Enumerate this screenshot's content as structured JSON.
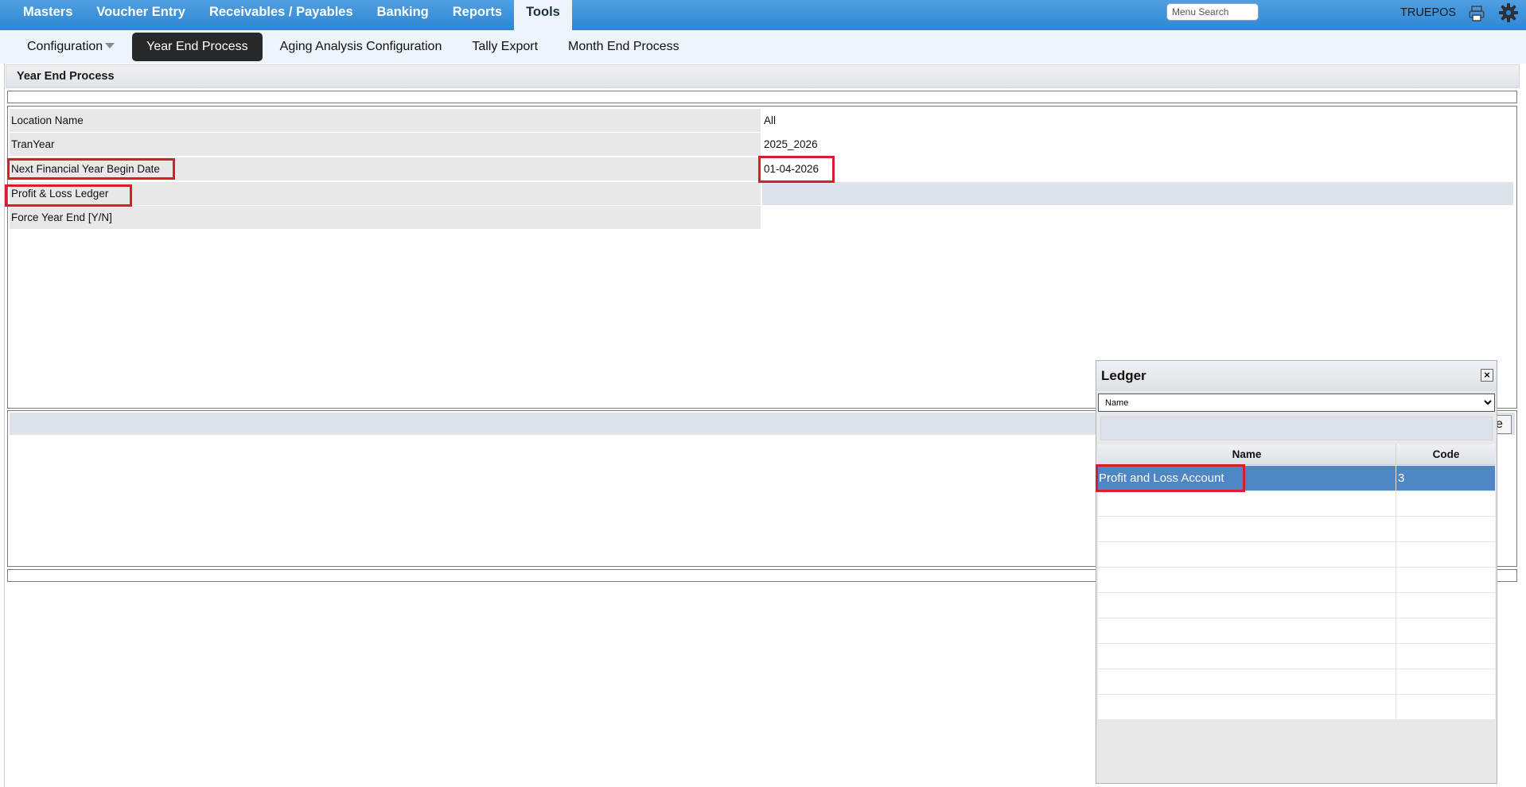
{
  "top_nav": {
    "items": [
      "Masters",
      "Voucher Entry",
      "Receivables / Payables",
      "Banking",
      "Reports",
      "Tools"
    ],
    "active": "Tools",
    "search_placeholder": "Menu Search",
    "username": "TRUEPOS",
    "icons": [
      "printer-icon",
      "gear-icon"
    ]
  },
  "sub_nav": {
    "items": [
      "Configuration",
      "Year End Process",
      "Aging Analysis Configuration",
      "Tally Export",
      "Month End Process"
    ],
    "active": "Year End Process"
  },
  "panel": {
    "title": "Year End Process",
    "fields": [
      {
        "label": "Location Name",
        "value": "All"
      },
      {
        "label": "TranYear",
        "value": "2025_2026"
      },
      {
        "label": "Next Financial Year Begin Date",
        "value": "01-04-2026"
      },
      {
        "label": "Profit & Loss Ledger",
        "value": ""
      },
      {
        "label": "Force Year End [Y/N]",
        "value": ""
      }
    ],
    "partial_button_text": "e"
  },
  "ledger_popup": {
    "title": "Ledger",
    "close_label": "×",
    "search_by": "Name",
    "columns": [
      "Name",
      "Code"
    ],
    "rows": [
      {
        "name": "Profit and Loss Account",
        "code": "3",
        "selected": true
      }
    ],
    "empty_rows": 9
  },
  "colors": {
    "nav_blue": "#2f86d3",
    "highlight_red": "#d81e2a",
    "selected_row": "#4f86c4"
  }
}
